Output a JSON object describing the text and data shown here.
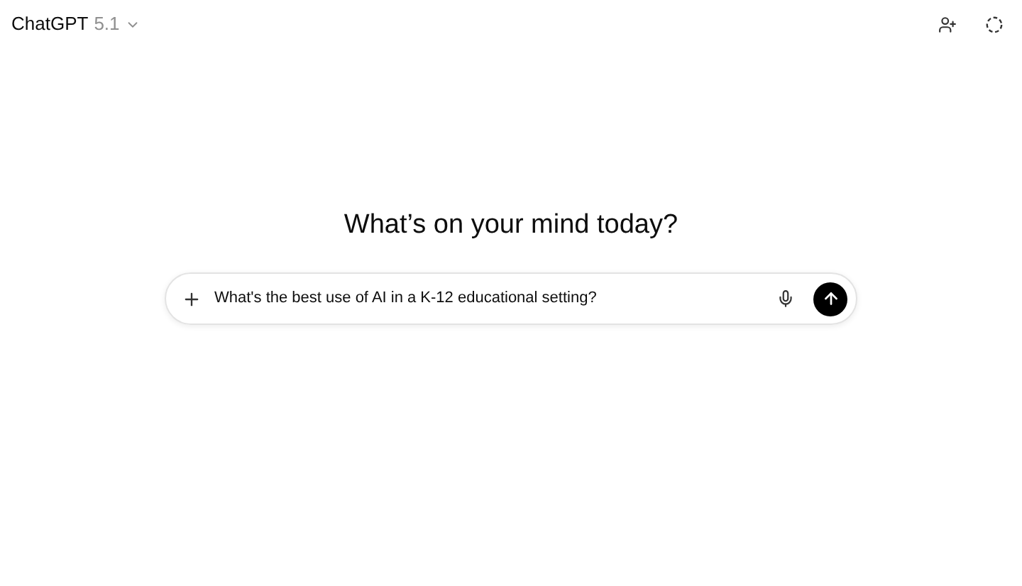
{
  "header": {
    "app_name": "ChatGPT",
    "model_version": "5.1"
  },
  "heading": "What’s on your mind today?",
  "composer": {
    "value": "What's the best use of AI in a K-12 educational setting?"
  }
}
